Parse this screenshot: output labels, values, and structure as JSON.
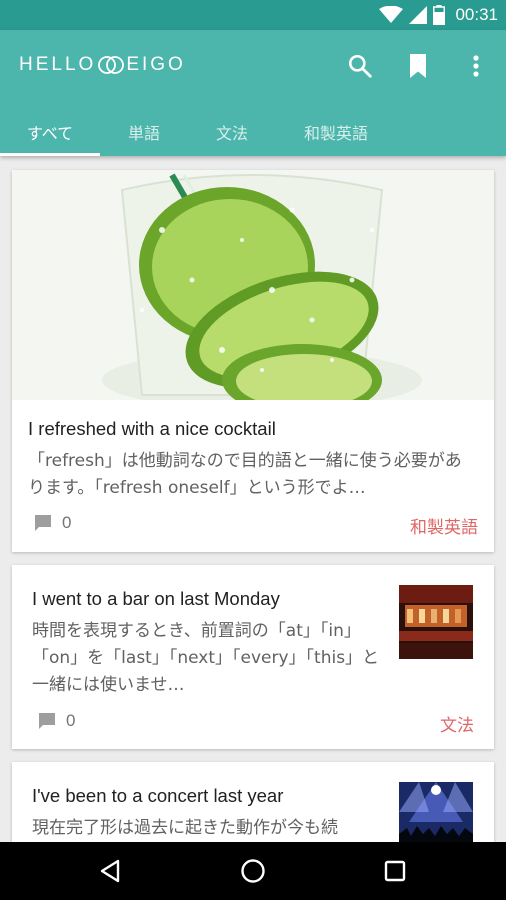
{
  "status_bar": {
    "time": "00:31",
    "icons": [
      "wifi-icon",
      "signal-icon",
      "battery-icon"
    ]
  },
  "app_bar": {
    "logo_left": "HELLO",
    "logo_right": "EIGO",
    "actions": [
      "search-icon",
      "bookmark-icon",
      "more-vert-icon"
    ]
  },
  "tabs": [
    {
      "label": "すべて",
      "active": true
    },
    {
      "label": "単語",
      "active": false
    },
    {
      "label": "文法",
      "active": false
    },
    {
      "label": "和製英語",
      "active": false
    }
  ],
  "articles": [
    {
      "title": "I refreshed with a nice cocktail",
      "excerpt": "「refresh」は他動詞なので目的語と一緒に使う必要があります。「refresh oneself」という形でよ…",
      "comments": "0",
      "category": "和製英語",
      "image": "lime-cocktail-image"
    },
    {
      "title": "I went to a bar on last Monday",
      "excerpt": "時間を表現するとき、前置詞の「at」「in」「on」を「last」「next」「every」「this」と一緒には使いませ…",
      "comments": "0",
      "category": "文法",
      "image": "bar-thumbnail"
    },
    {
      "title": "I've been to a concert last year",
      "excerpt": "現在完了形は過去に起きた動作が今も続",
      "image": "concert-thumbnail"
    }
  ],
  "colors": {
    "primary": "#4db6ac",
    "status_bar": "#2a9b90",
    "category": "#e06666"
  },
  "nav_bar": [
    "back-icon",
    "home-icon",
    "recents-icon"
  ]
}
